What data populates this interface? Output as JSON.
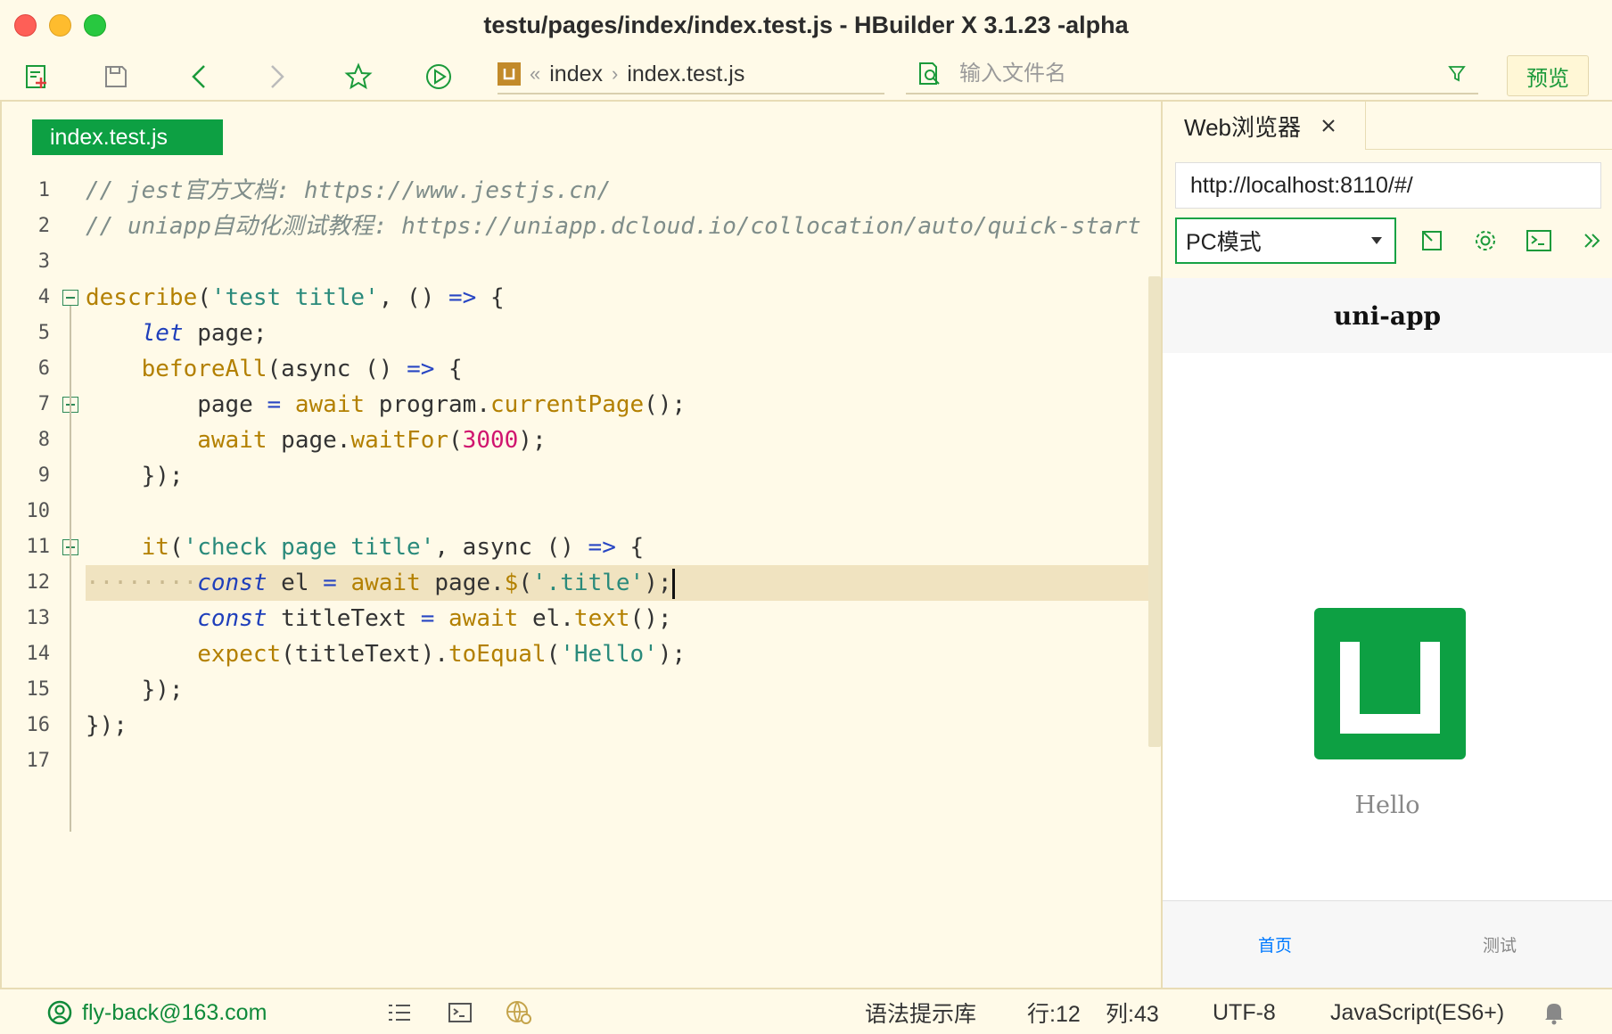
{
  "window": {
    "title": "testu/pages/index/index.test.js - HBuilder X 3.1.23 -alpha"
  },
  "toolbar": {
    "icons": [
      "new-file-icon",
      "save-icon",
      "back-icon",
      "forward-icon",
      "star-icon",
      "run-icon"
    ],
    "breadcrumb": {
      "project_icon": "uni-app-icon",
      "items": [
        "index",
        "index.test.js"
      ]
    },
    "search": {
      "placeholder": "输入文件名",
      "filter_icon": "filter-icon"
    },
    "preview_label": "预览"
  },
  "editor": {
    "tab_label": "index.test.js",
    "line_numbers": [
      "1",
      "2",
      "3",
      "4",
      "5",
      "6",
      "7",
      "8",
      "9",
      "10",
      "11",
      "12",
      "13",
      "14",
      "15",
      "16",
      "17"
    ],
    "current_line": 12
  },
  "browser": {
    "tab_label": "Web浏览器",
    "url": "http://localhost:8110/#/",
    "mode": "PC模式",
    "simulator": {
      "nav_title": "uni-app",
      "content_text": "Hello",
      "tabbar": [
        "首页",
        "测试"
      ]
    }
  },
  "statusbar": {
    "account": "fly-back@163.com",
    "syntax_lib": "语法提示库",
    "row": "行:12",
    "col": "列:43",
    "encoding": "UTF-8",
    "language": "JavaScript(ES6+)"
  },
  "colors": {
    "accent_green": "#0da043",
    "editor_bg": "#fffae8",
    "current_line_bg": "#f0e3c0"
  }
}
